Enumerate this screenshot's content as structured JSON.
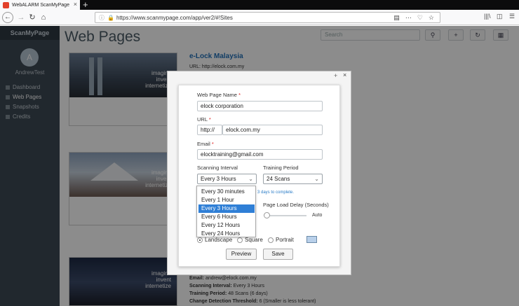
{
  "browser": {
    "tab_title": "WebALARM ScanMyPage",
    "new_tab": "+",
    "tab_close": "×",
    "url": "https://www.scanmypage.com/app/ver2/#!Sites"
  },
  "sidebar": {
    "brand": "ScanMyPage",
    "avatar_letter": "A",
    "user_name": "AndrewTest",
    "items": [
      {
        "label": "Dashboard"
      },
      {
        "label": "Web Pages"
      },
      {
        "label": "Snapshots"
      },
      {
        "label": "Credits"
      }
    ]
  },
  "main": {
    "title": "Web Pages",
    "search_placeholder": "Search",
    "site_title": "e-Lock Malaysia",
    "site_url": "URL: http://elock.com.my",
    "thumb_tagline": [
      "imagine",
      "invent",
      "internetize"
    ],
    "details": [
      {
        "label": "Email:",
        "value": " andrew@elock.com.my"
      },
      {
        "label": "Scanning Interval:",
        "value": " Every 3 Hours"
      },
      {
        "label": "Training Period:",
        "value": " 48 Scans (6 days)"
      },
      {
        "label": "Change Detection Threshold:",
        "value": " 6 (Smaller is less tolerant)"
      }
    ]
  },
  "modal": {
    "plus": "+",
    "close": "×",
    "name_label": "Web Page Name",
    "name_value": "elock corporation",
    "url_label": "URL",
    "url_prefix": "http://",
    "url_value": "elock.com.my",
    "email_label": "Email",
    "email_value": "elocktraining@gmail.com",
    "interval_label": "Scanning Interval",
    "interval_value": "Every 3 Hours",
    "training_label": "Training Period",
    "training_value": "24 Scans",
    "training_hint": "3 days to complete.",
    "delay_label": "Page Load Delay (Seconds)",
    "delay_value": "Auto",
    "orientation": [
      "Landscape",
      "Square",
      "Portrait"
    ],
    "preview_button": "Preview",
    "save_button": "Save",
    "required_mark": "*"
  },
  "interval_options": [
    "Every 30 minutes",
    "Every 1 Hour",
    "Every 3 Hours",
    "Every 6 Hours",
    "Every 12 Hours",
    "Every 24 Hours"
  ],
  "interval_selected_index": 2
}
